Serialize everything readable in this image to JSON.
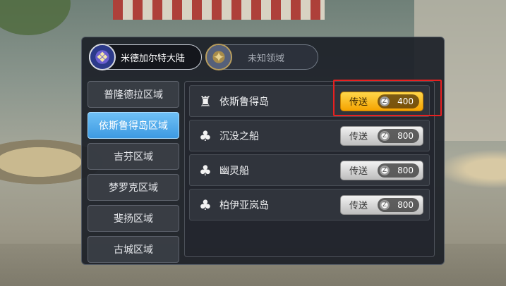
{
  "regions": [
    {
      "label": "米德加尔特大陆",
      "icon": "blue-crest-emblem"
    },
    {
      "label": "未知领域",
      "icon": "gold-crest-emblem"
    }
  ],
  "zones": [
    {
      "label": "普隆德拉区域"
    },
    {
      "label": "依斯鲁得岛区域"
    },
    {
      "label": "吉芬区域"
    },
    {
      "label": "梦罗克区域"
    },
    {
      "label": "斐扬区域"
    },
    {
      "label": "古城区域"
    }
  ],
  "destinations": [
    {
      "name": "依斯鲁得岛",
      "icon": "castle-icon",
      "button_label": "传送",
      "cost": "400",
      "highlighted": true
    },
    {
      "name": "沉没之船",
      "icon": "forest-icon",
      "button_label": "传送",
      "cost": "800"
    },
    {
      "name": "幽灵船",
      "icon": "forest-icon",
      "button_label": "传送",
      "cost": "800"
    },
    {
      "name": "柏伊亚岚岛",
      "icon": "forest-icon",
      "button_label": "传送",
      "cost": "800"
    }
  ],
  "colors": {
    "selected_zone": "#3d9ae2",
    "primary_button": "#f5a300",
    "highlight_box": "#e82020"
  }
}
